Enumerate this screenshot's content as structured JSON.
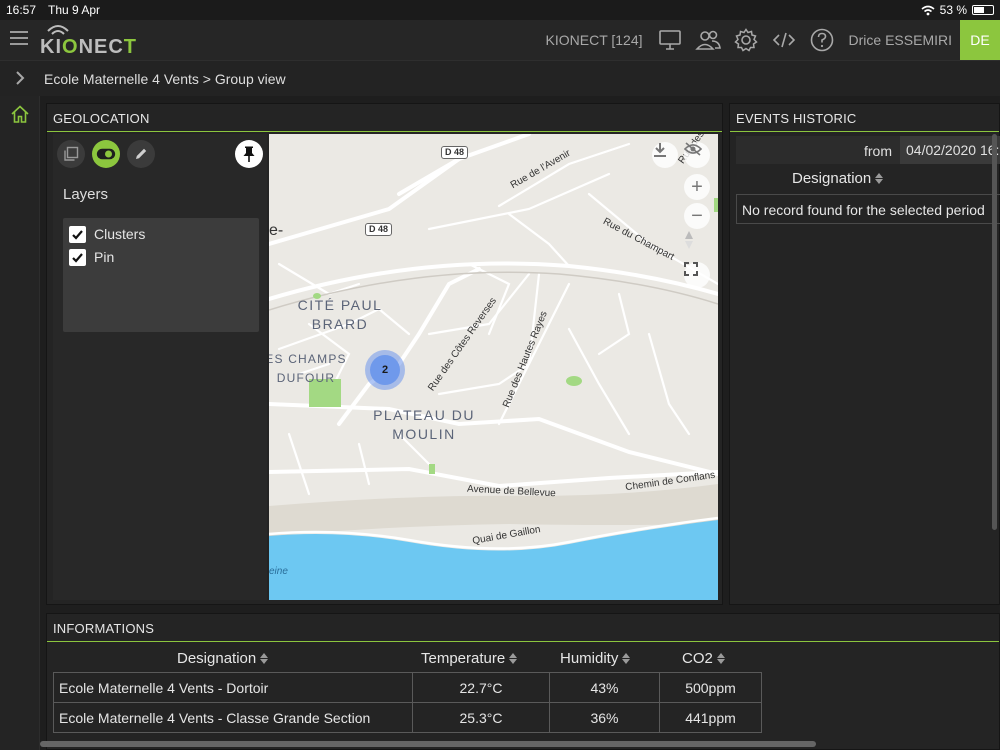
{
  "statusbar": {
    "time": "16:57",
    "date": "Thu 9 Apr",
    "battery": "53 %",
    "battery_level": 0.53
  },
  "header": {
    "logo": "KIONECT",
    "app_name": "KIONECT [124]",
    "user_name": "Drice ESSEMIRI",
    "user_initials": "DE"
  },
  "breadcrumb": "Ecole Maternelle 4 Vents > Group view",
  "geolocation": {
    "title": "GEOLOCATION",
    "layers_title": "Layers",
    "layers": [
      {
        "label": "Clusters",
        "checked": true
      },
      {
        "label": "Pin",
        "checked": true
      }
    ],
    "map": {
      "cluster_count": "2",
      "district_labels": [
        "CITÉ PAUL BRARD",
        "ES CHAMPS DUFOUR",
        "PLATEAU DU MOULIN"
      ],
      "road_labels": [
        "Rue de l'Avenir",
        "Rue du Champart",
        "Rue des Côtes Reverses",
        "Rue des Hautes Rayes",
        "Avenue de Bellevue",
        "Chemin de Conflans",
        "Quai de Gaillon",
        "eine",
        "e-",
        "Rue des"
      ],
      "route_badges": [
        "D 48",
        "D 48"
      ],
      "zoom_in": "+",
      "zoom_out": "−"
    }
  },
  "events": {
    "title": "EVENTS HISTORIC",
    "from_label": "from",
    "from_value": "04/02/2020 16:",
    "column": "Designation",
    "empty_message": "No record found for the selected period"
  },
  "informations": {
    "title": "INFORMATIONS",
    "columns": [
      "Designation",
      "Temperature",
      "Humidity",
      "CO2"
    ],
    "rows": [
      [
        "Ecole Maternelle 4 Vents - Dortoir",
        "22.7°C",
        "43%",
        "500ppm"
      ],
      [
        "Ecole Maternelle 4 Vents - Classe Grande Section",
        "25.3°C",
        "36%",
        "441ppm"
      ]
    ]
  },
  "colors": {
    "accent": "#8cc63e",
    "background": "#1e1e1e",
    "panel": "#242424",
    "river": "#6dc8f2",
    "cluster": "#6f99eb"
  }
}
